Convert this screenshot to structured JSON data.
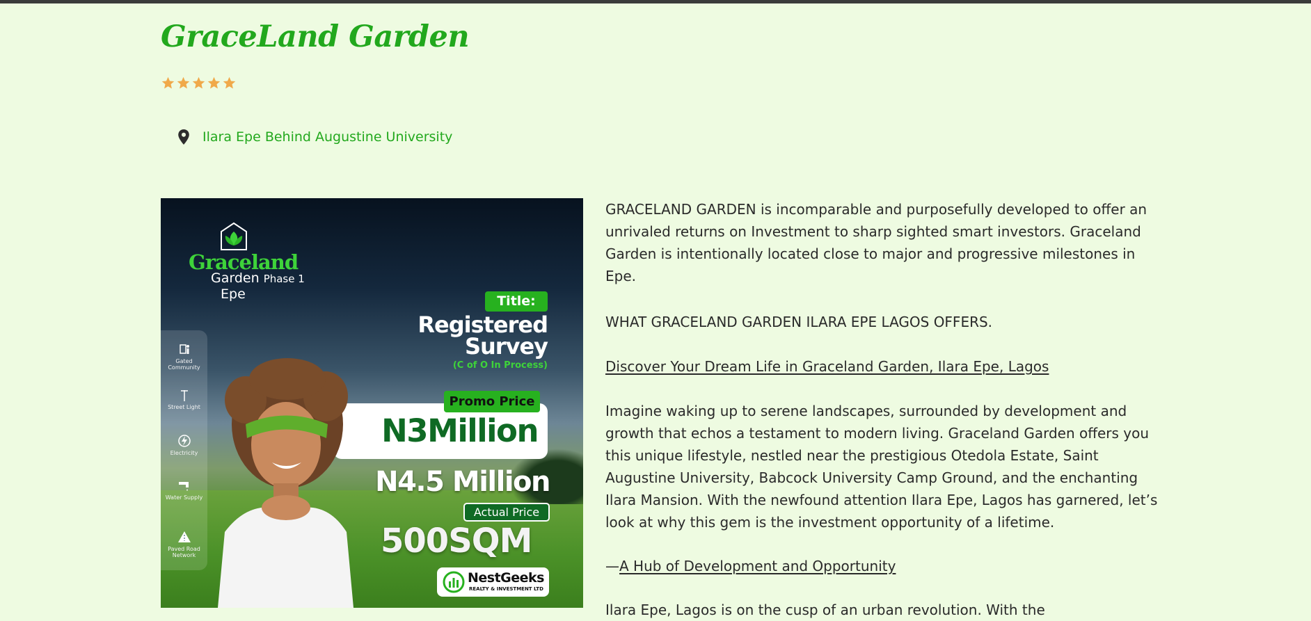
{
  "property": {
    "title": "GraceLand Garden",
    "rating_stars": 5,
    "location": "Ilara Epe Behind Augustine University"
  },
  "promo_image": {
    "brand": "Graceland",
    "brand_sub": "Garden",
    "phase": "Phase 1",
    "brand_epe": "Epe",
    "title_label": "Title:",
    "survey_line1": "Registered",
    "survey_line2": "Survey",
    "coo_note": "(C of O In Process)",
    "promo_label": "Promo Price",
    "promo_price": "N3Million",
    "actual_price": "N4.5 Million",
    "actual_label": "Actual Price",
    "plot_size": "500SQM",
    "agency_name": "NestGeeks",
    "agency_sub": "REALTY & INVESTMENT LTD",
    "amenities": [
      {
        "label": "Gated Community",
        "icon": "gated-community-icon"
      },
      {
        "label": "Street Light",
        "icon": "street-light-icon"
      },
      {
        "label": "Electricity",
        "icon": "electricity-icon"
      },
      {
        "label": "Water Supply",
        "icon": "water-supply-icon"
      },
      {
        "label": "Paved Road Network",
        "icon": "road-icon"
      }
    ]
  },
  "description": {
    "intro": "GRACELAND GARDEN is incomparable and purposefully developed to offer an unrivaled returns on Investment to sharp sighted smart investors. Graceland Garden is intentionally located close to major and progressive milestones in Epe.",
    "offers_heading": "WHAT GRACELAND GARDEN ILARA EPE LAGOS OFFERS.",
    "discover_link": "Discover Your Dream Life in Graceland Garden, Ilara Epe, Lagos",
    "imagine": "Imagine waking up to serene landscapes, surrounded by development and growth that echos a testament to modern living. Graceland Garden offers you this unique lifestyle, nestled near the prestigious Otedola Estate, Saint Augustine University, Babcock University Camp Ground, and the enchanting Ilara Mansion. With the newfound attention Ilara Epe, Lagos has garnered, let’s look at why this gem is the investment opportunity of a lifetime.",
    "hub_prefix": "—",
    "hub_link": "A Hub of Development and Opportunity",
    "cutoff": "Ilara Epe, Lagos is on the cusp of an urban revolution. With the"
  },
  "colors": {
    "background": "#eefbe1",
    "accent_green": "#22a81d",
    "star": "#f0a94a",
    "text": "#2a2a2a"
  }
}
